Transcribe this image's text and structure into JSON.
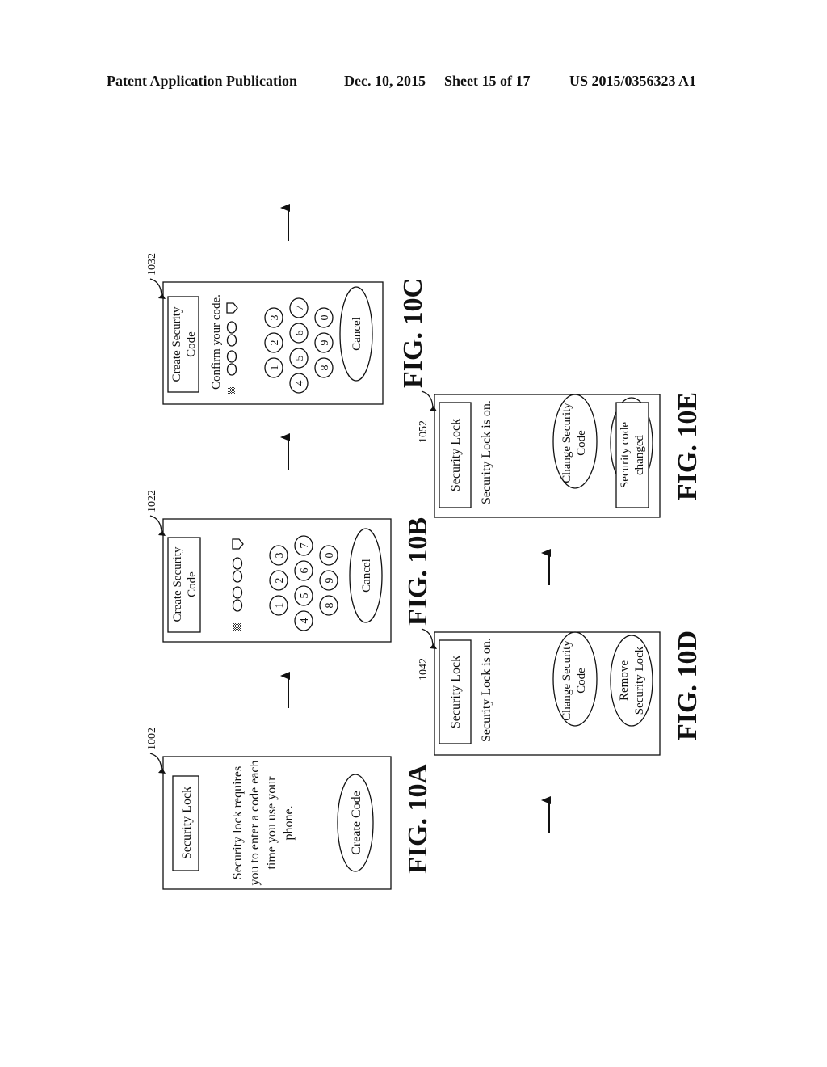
{
  "header": {
    "publication": "Patent Application Publication",
    "date": "Dec. 10, 2015",
    "sheet": "Sheet 15 of 17",
    "number": "US 2015/0356323 A1"
  },
  "figures": {
    "fig10a": {
      "label": "FIG. 10A",
      "ref": "1002",
      "title": "Security Lock",
      "body_lines": [
        "Security lock requires",
        "you to enter a code each",
        "time you use your",
        "phone."
      ],
      "button": "Create Code"
    },
    "fig10b": {
      "label": "FIG. 10B",
      "ref": "1022",
      "title_lines": [
        "Create Security",
        "Code"
      ],
      "keypad": [
        "1",
        "2",
        "3",
        "4",
        "5",
        "6",
        "7",
        "8",
        "9",
        "0"
      ],
      "button": "Cancel"
    },
    "fig10c": {
      "label": "FIG. 10C",
      "ref": "1032",
      "title_lines": [
        "Create Security",
        "Code"
      ],
      "prompt": "Confirm your code.",
      "keypad": [
        "1",
        "2",
        "3",
        "4",
        "5",
        "6",
        "7",
        "8",
        "9",
        "0"
      ],
      "button": "Cancel"
    },
    "fig10d": {
      "label": "FIG. 10D",
      "ref": "1042",
      "title": "Security Lock",
      "status": "Security Lock is on.",
      "button1_lines": [
        "Change Security",
        "Code"
      ],
      "button2_lines": [
        "Remove",
        "Security Lock"
      ]
    },
    "fig10e": {
      "label": "FIG. 10E",
      "ref": "1052",
      "title": "Security Lock",
      "status": "Security Lock is on.",
      "button1_lines": [
        "Change Security",
        "Code"
      ],
      "toast_lines": [
        "Security code",
        "changed"
      ]
    }
  },
  "icons": {
    "flow_arrow": "arrow-up",
    "pin_slot": "circle-outline",
    "backspace": "backspace-pentagon",
    "keyboard_toggle": "hatched-square"
  }
}
